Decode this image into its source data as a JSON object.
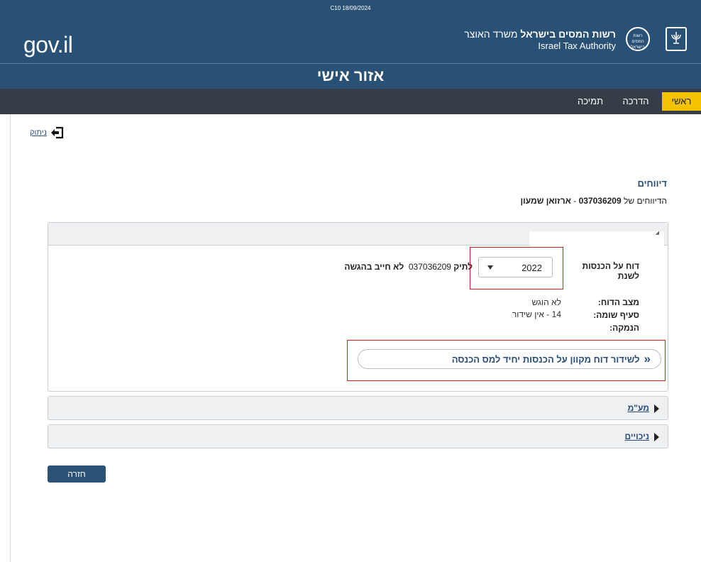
{
  "header": {
    "release": "C10 18/09/2024",
    "logo_text": "gov.il",
    "authority_bold": "רשות המסים בישראל",
    "authority_ministry": "משרד האוצר",
    "authority_en": "Israel Tax Authority",
    "emblem_text": "רשות המסים בישראל",
    "area_title": "אזור אישי",
    "bg_color": "#285175"
  },
  "nav": {
    "items": [
      {
        "label": "ראשי",
        "active": true
      },
      {
        "label": "הדרכה",
        "active": false
      },
      {
        "label": "תמיכה",
        "active": false
      }
    ],
    "active_color": "#f3c300",
    "bg_color": "#353d46"
  },
  "logout": {
    "label": "ניתוק",
    "icon": "logout-icon"
  },
  "reports": {
    "title": "דיווחים",
    "subtitle_prefix": "הדיווחים של",
    "file_number": "037036209",
    "subtitle_sep": "-",
    "name": "ארזואן שמעון"
  },
  "report": {
    "year_label": "דוח על הכנסות לשנת",
    "year_value": "2022",
    "file_label": "לתיק",
    "file_number": "037036209",
    "obligation": "לא חייב בהגשה",
    "status_label": "מצב הדוח:",
    "status_value": "לא הוגש",
    "clause_label": "סעיף שומה:",
    "clause_value": "14 - אין שידור",
    "reason_label": "הנמקה:",
    "submit_label": "לשידור דוח מקוון על הכנסות יחיד למס הכנסה"
  },
  "accordions": [
    {
      "title": "מע\"מ"
    },
    {
      "title": "ניכויים"
    }
  ],
  "back_button": "חזרה"
}
